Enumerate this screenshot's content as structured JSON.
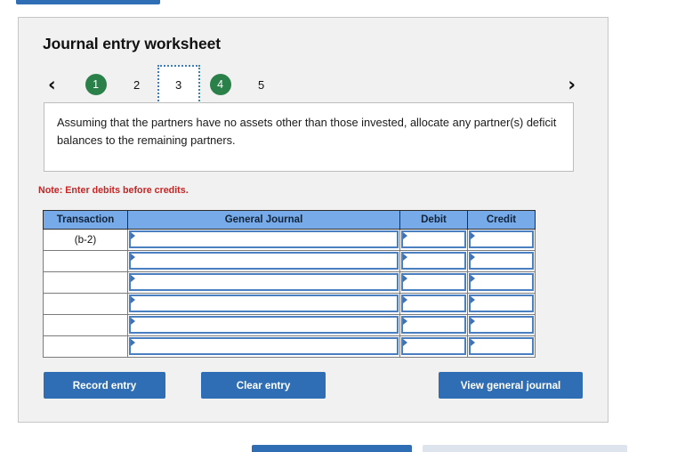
{
  "top_bar": {
    "present": true,
    "color": "#2f6eb5"
  },
  "panel": {
    "title": "Journal entry worksheet",
    "background": "#f1f1f1",
    "border_color": "#c6c6c6"
  },
  "stepper": {
    "prev_icon": "‹",
    "next_icon": "›",
    "completed_color": "#2b8049",
    "current_outline_color": "#3a7ebf",
    "steps": [
      {
        "label": "1",
        "state": "completed"
      },
      {
        "label": "2",
        "state": "default"
      },
      {
        "label": "3",
        "state": "current"
      },
      {
        "label": "4",
        "state": "completed"
      },
      {
        "label": "5",
        "state": "default"
      }
    ]
  },
  "prompt": {
    "text": "Assuming that the partners have no assets other than those invested, allocate any partner(s) deficit balances to the remaining partners."
  },
  "note": {
    "text": "Note: Enter debits before credits.",
    "color": "#cc2222"
  },
  "table": {
    "header_color": "#76aae8",
    "columns": [
      "Transaction",
      "General Journal",
      "Debit",
      "Credit"
    ],
    "rows": [
      {
        "transaction": "(b-2)",
        "general_journal": "",
        "debit": "",
        "credit": ""
      },
      {
        "transaction": "",
        "general_journal": "",
        "debit": "",
        "credit": ""
      },
      {
        "transaction": "",
        "general_journal": "",
        "debit": "",
        "credit": ""
      },
      {
        "transaction": "",
        "general_journal": "",
        "debit": "",
        "credit": ""
      },
      {
        "transaction": "",
        "general_journal": "",
        "debit": "",
        "credit": ""
      },
      {
        "transaction": "",
        "general_journal": "",
        "debit": "",
        "credit": ""
      }
    ]
  },
  "actions": {
    "record_label": "Record entry",
    "clear_label": "Clear entry",
    "view_label": "View general journal",
    "button_color": "#2f6eb5"
  },
  "bottom_bar": {
    "primary_color": "#2f6eb5",
    "secondary_color": "#dde4ee"
  }
}
